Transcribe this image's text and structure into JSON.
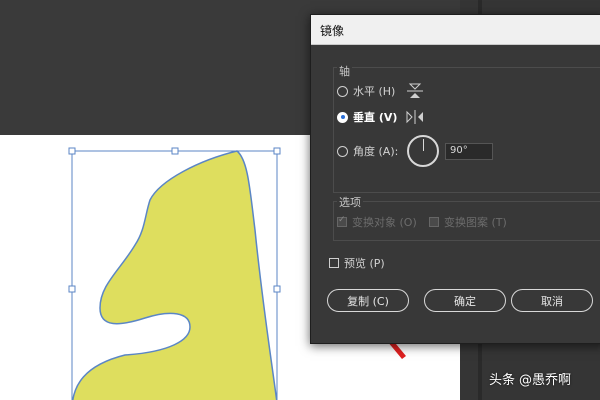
{
  "dialog": {
    "title": "镜像",
    "axis_group_label": "轴",
    "radio_horizontal": "水平 (H)",
    "radio_vertical": "垂直 (V)",
    "radio_angle": "角度 (A):",
    "angle_value": "90°",
    "selected_axis": "vertical",
    "options_group_label": "选项",
    "option_transform_objects": "变换对象 (O)",
    "option_transform_patterns": "变换图案 (T)",
    "preview_label": "预览 (P)",
    "copy_button": "复制 (C)",
    "ok_button": "确定",
    "cancel_button": "取消"
  },
  "colors": {
    "shape_fill": "#dede5e",
    "shape_stroke": "#5b86c5",
    "selection_box": "#5b86c5",
    "arrow": "#e02020"
  },
  "watermark": {
    "brand": "头条",
    "author": "@愚乔啊"
  }
}
